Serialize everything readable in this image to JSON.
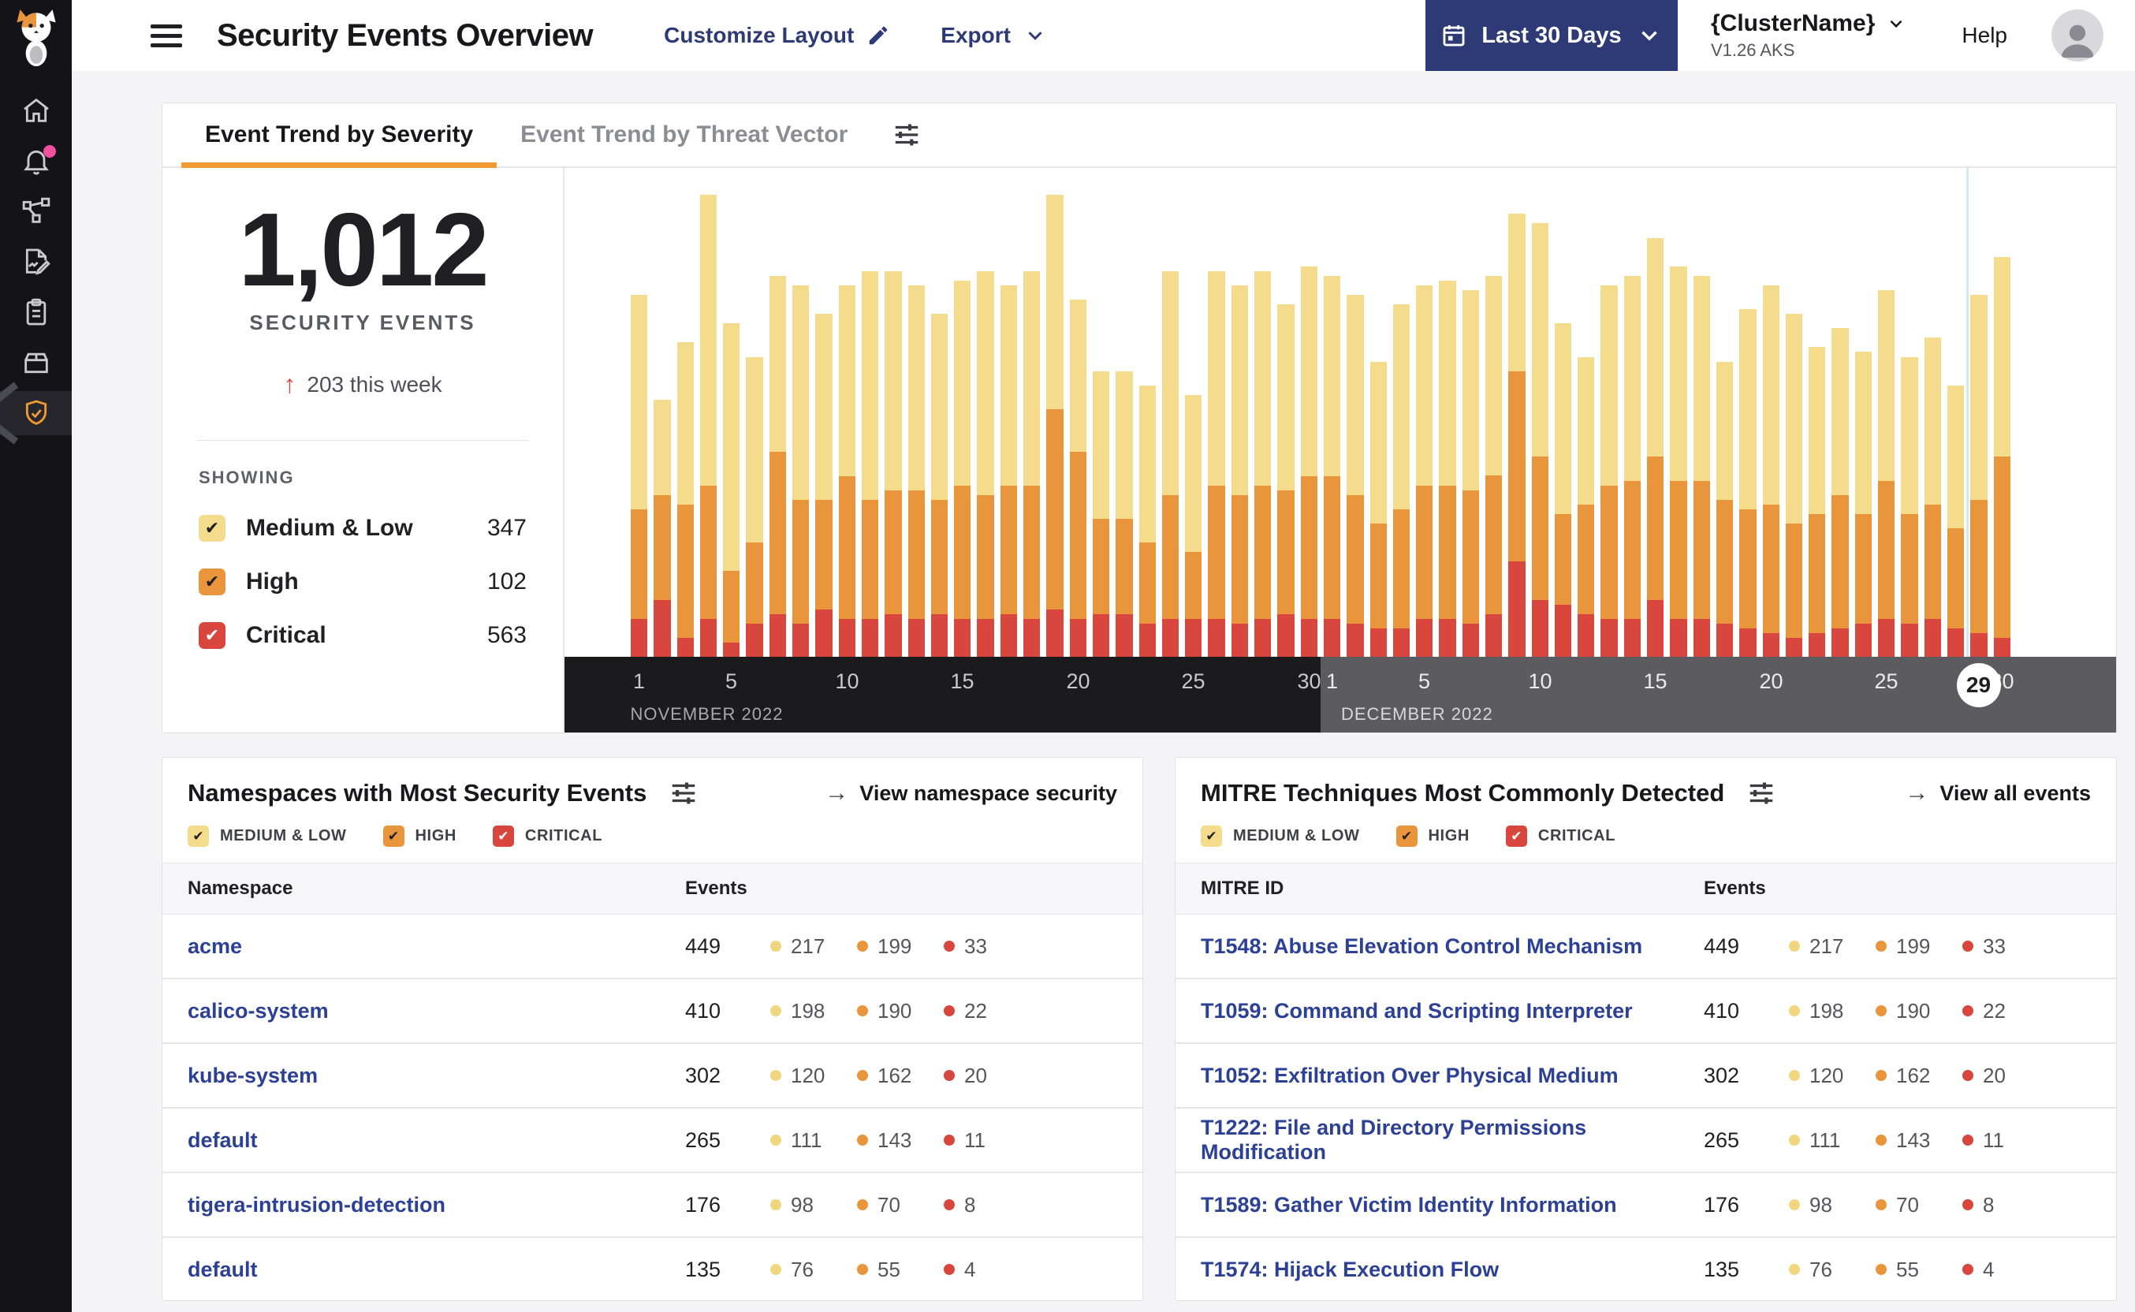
{
  "icons": {
    "check": "✔",
    "arrow_right": "→",
    "trend_up": "↑"
  },
  "colors": {
    "medium_low": "#f4dc8c",
    "high": "#e8953c",
    "critical": "#d8463e",
    "accent_orange": "#ef9a32",
    "navy": "#2d3a76",
    "link_blue": "#2c4195",
    "alert_pink": "#f0509e",
    "axis_november_bg": "#1b1b1e",
    "axis_december_bg": "#5c5c60",
    "hover_line_blue": "#d2e8f4"
  },
  "sidebar": {
    "items": [
      {
        "icon": "calico-cat-logo"
      },
      {
        "icon": "home-icon"
      },
      {
        "icon": "bell-icon",
        "badge": true
      },
      {
        "icon": "service-graph-icon"
      },
      {
        "icon": "report-edit-icon"
      },
      {
        "icon": "clipboard-icon"
      },
      {
        "icon": "box-icon"
      },
      {
        "icon": "shield-check-icon",
        "active": true
      }
    ]
  },
  "header": {
    "title": "Security Events Overview",
    "customize_label": "Customize Layout",
    "export_label": "Export",
    "date_range_label": "Last 30 Days",
    "cluster_name": "{ClusterName}",
    "cluster_version": "V1.26 AKS",
    "help_label": "Help"
  },
  "tabs": [
    {
      "label": "Event Trend by Severity",
      "active": true
    },
    {
      "label": "Event Trend by Threat Vector",
      "active": false
    }
  ],
  "summary": {
    "total": "1,012",
    "events_label": "SECURITY EVENTS",
    "delta": "203 this week",
    "showing_label": "SHOWING",
    "legend": [
      {
        "label": "Medium & Low",
        "count": "347",
        "severity": "medium_low"
      },
      {
        "label": "High",
        "count": "102",
        "severity": "high"
      },
      {
        "label": "Critical",
        "count": "563",
        "severity": "critical"
      }
    ]
  },
  "chart_data": {
    "type": "bar",
    "stacked": true,
    "legend_position": "left-panel",
    "grid": false,
    "series_names": [
      "Critical",
      "High",
      "Medium & Low"
    ],
    "value_unit": "percent of plot height (no y-axis shown in UI)",
    "selected_day_index": 58,
    "months": [
      {
        "label": "NOVEMBER 2022",
        "ticks": [
          1,
          5,
          10,
          15,
          20,
          25,
          30
        ]
      },
      {
        "label": "DECEMBER 2022",
        "ticks": [
          1,
          5,
          10,
          15,
          20,
          25,
          30
        ],
        "highlight_day": 29
      }
    ],
    "days": [
      {
        "date": "Nov 1",
        "critical": 8,
        "high": 23,
        "mediumLow": 45
      },
      {
        "date": "Nov 2",
        "critical": 12,
        "high": 22,
        "mediumLow": 20
      },
      {
        "date": "Nov 3",
        "critical": 4,
        "high": 28,
        "mediumLow": 34
      },
      {
        "date": "Nov 4",
        "critical": 8,
        "high": 28,
        "mediumLow": 61
      },
      {
        "date": "Nov 5",
        "critical": 3,
        "high": 15,
        "mediumLow": 52
      },
      {
        "date": "Nov 6",
        "critical": 7,
        "high": 17,
        "mediumLow": 39
      },
      {
        "date": "Nov 7",
        "critical": 9,
        "high": 34,
        "mediumLow": 37
      },
      {
        "date": "Nov 8",
        "critical": 7,
        "high": 26,
        "mediumLow": 45
      },
      {
        "date": "Nov 9",
        "critical": 10,
        "high": 23,
        "mediumLow": 39
      },
      {
        "date": "Nov 10",
        "critical": 8,
        "high": 30,
        "mediumLow": 40
      },
      {
        "date": "Nov 11",
        "critical": 8,
        "high": 25,
        "mediumLow": 48
      },
      {
        "date": "Nov 12",
        "critical": 9,
        "high": 26,
        "mediumLow": 46
      },
      {
        "date": "Nov 13",
        "critical": 8,
        "high": 27,
        "mediumLow": 43
      },
      {
        "date": "Nov 14",
        "critical": 9,
        "high": 24,
        "mediumLow": 39
      },
      {
        "date": "Nov 15",
        "critical": 8,
        "high": 28,
        "mediumLow": 43
      },
      {
        "date": "Nov 16",
        "critical": 8,
        "high": 26,
        "mediumLow": 47
      },
      {
        "date": "Nov 17",
        "critical": 9,
        "high": 27,
        "mediumLow": 42
      },
      {
        "date": "Nov 18",
        "critical": 8,
        "high": 28,
        "mediumLow": 45
      },
      {
        "date": "Nov 19",
        "critical": 10,
        "high": 42,
        "mediumLow": 45
      },
      {
        "date": "Nov 20",
        "critical": 8,
        "high": 35,
        "mediumLow": 32
      },
      {
        "date": "Nov 21",
        "critical": 9,
        "high": 20,
        "mediumLow": 31
      },
      {
        "date": "Nov 22",
        "critical": 9,
        "high": 20,
        "mediumLow": 31
      },
      {
        "date": "Nov 23",
        "critical": 7,
        "high": 17,
        "mediumLow": 33
      },
      {
        "date": "Nov 24",
        "critical": 8,
        "high": 26,
        "mediumLow": 47
      },
      {
        "date": "Nov 25",
        "critical": 8,
        "high": 14,
        "mediumLow": 33
      },
      {
        "date": "Nov 26",
        "critical": 8,
        "high": 28,
        "mediumLow": 45
      },
      {
        "date": "Nov 27",
        "critical": 7,
        "high": 27,
        "mediumLow": 44
      },
      {
        "date": "Nov 28",
        "critical": 8,
        "high": 28,
        "mediumLow": 45
      },
      {
        "date": "Nov 29",
        "critical": 9,
        "high": 26,
        "mediumLow": 39
      },
      {
        "date": "Nov 30",
        "critical": 8,
        "high": 30,
        "mediumLow": 44
      },
      {
        "date": "Dec 1",
        "critical": 8,
        "high": 30,
        "mediumLow": 42
      },
      {
        "date": "Dec 2",
        "critical": 7,
        "high": 27,
        "mediumLow": 42
      },
      {
        "date": "Dec 3",
        "critical": 6,
        "high": 22,
        "mediumLow": 34
      },
      {
        "date": "Dec 4",
        "critical": 6,
        "high": 25,
        "mediumLow": 43
      },
      {
        "date": "Dec 5",
        "critical": 8,
        "high": 28,
        "mediumLow": 42
      },
      {
        "date": "Dec 6",
        "critical": 8,
        "high": 28,
        "mediumLow": 43
      },
      {
        "date": "Dec 7",
        "critical": 7,
        "high": 28,
        "mediumLow": 42
      },
      {
        "date": "Dec 8",
        "critical": 9,
        "high": 29,
        "mediumLow": 42
      },
      {
        "date": "Dec 9",
        "critical": 20,
        "high": 40,
        "mediumLow": 33
      },
      {
        "date": "Dec 10",
        "critical": 12,
        "high": 30,
        "mediumLow": 49
      },
      {
        "date": "Dec 11",
        "critical": 11,
        "high": 19,
        "mediumLow": 40
      },
      {
        "date": "Dec 12",
        "critical": 9,
        "high": 23,
        "mediumLow": 31
      },
      {
        "date": "Dec 13",
        "critical": 8,
        "high": 28,
        "mediumLow": 42
      },
      {
        "date": "Dec 14",
        "critical": 8,
        "high": 29,
        "mediumLow": 43
      },
      {
        "date": "Dec 15",
        "critical": 12,
        "high": 30,
        "mediumLow": 46
      },
      {
        "date": "Dec 16",
        "critical": 8,
        "high": 29,
        "mediumLow": 45
      },
      {
        "date": "Dec 17",
        "critical": 8,
        "high": 29,
        "mediumLow": 43
      },
      {
        "date": "Dec 18",
        "critical": 7,
        "high": 26,
        "mediumLow": 29
      },
      {
        "date": "Dec 19",
        "critical": 6,
        "high": 25,
        "mediumLow": 42
      },
      {
        "date": "Dec 20",
        "critical": 5,
        "high": 27,
        "mediumLow": 46
      },
      {
        "date": "Dec 21",
        "critical": 4,
        "high": 24,
        "mediumLow": 44
      },
      {
        "date": "Dec 22",
        "critical": 5,
        "high": 25,
        "mediumLow": 35
      },
      {
        "date": "Dec 23",
        "critical": 6,
        "high": 28,
        "mediumLow": 35
      },
      {
        "date": "Dec 24",
        "critical": 7,
        "high": 23,
        "mediumLow": 34
      },
      {
        "date": "Dec 25",
        "critical": 8,
        "high": 29,
        "mediumLow": 40
      },
      {
        "date": "Dec 26",
        "critical": 7,
        "high": 23,
        "mediumLow": 33
      },
      {
        "date": "Dec 27",
        "critical": 8,
        "high": 24,
        "mediumLow": 35
      },
      {
        "date": "Dec 28",
        "critical": 6,
        "high": 21,
        "mediumLow": 30
      },
      {
        "date": "Dec 29",
        "critical": 5,
        "high": 28,
        "mediumLow": 43
      },
      {
        "date": "Dec 30",
        "critical": 4,
        "high": 38,
        "mediumLow": 42
      }
    ]
  },
  "namespaces_card": {
    "title": "Namespaces with Most Security Events",
    "link_label": "View namespace security",
    "filters": [
      {
        "label": "MEDIUM & LOW",
        "severity": "medium_low",
        "checked": true
      },
      {
        "label": "HIGH",
        "severity": "high",
        "checked": true
      },
      {
        "label": "CRITICAL",
        "severity": "critical",
        "checked": true
      }
    ],
    "columns": [
      "Namespace",
      "Events"
    ],
    "rows": [
      {
        "name": "acme",
        "total": "449",
        "medium": "217",
        "high": "199",
        "critical": "33"
      },
      {
        "name": "calico-system",
        "total": "410",
        "medium": "198",
        "high": "190",
        "critical": "22"
      },
      {
        "name": "kube-system",
        "total": "302",
        "medium": "120",
        "high": "162",
        "critical": "20"
      },
      {
        "name": "default",
        "total": "265",
        "medium": "111",
        "high": "143",
        "critical": "11"
      },
      {
        "name": "tigera-intrusion-detection",
        "total": "176",
        "medium": "98",
        "high": "70",
        "critical": "8"
      },
      {
        "name": "default",
        "total": "135",
        "medium": "76",
        "high": "55",
        "critical": "4"
      }
    ]
  },
  "mitre_card": {
    "title": "MITRE Techniques Most Commonly Detected",
    "link_label": "View all events",
    "filters": [
      {
        "label": "MEDIUM & LOW",
        "severity": "medium_low",
        "checked": true
      },
      {
        "label": "HIGH",
        "severity": "high",
        "checked": true
      },
      {
        "label": "CRITICAL",
        "severity": "critical",
        "checked": true
      }
    ],
    "columns": [
      "MITRE ID",
      "Events"
    ],
    "rows": [
      {
        "name": "T1548: Abuse Elevation Control Mechanism",
        "total": "449",
        "medium": "217",
        "high": "199",
        "critical": "33"
      },
      {
        "name": "T1059: Command and Scripting Interpreter",
        "total": "410",
        "medium": "198",
        "high": "190",
        "critical": "22"
      },
      {
        "name": "T1052: Exfiltration Over Physical Medium",
        "total": "302",
        "medium": "120",
        "high": "162",
        "critical": "20"
      },
      {
        "name": "T1222: File and Directory Permissions Modification",
        "total": "265",
        "medium": "111",
        "high": "143",
        "critical": "11"
      },
      {
        "name": "T1589: Gather Victim Identity Information",
        "total": "176",
        "medium": "98",
        "high": "70",
        "critical": "8"
      },
      {
        "name": "T1574: Hijack Execution Flow",
        "total": "135",
        "medium": "76",
        "high": "55",
        "critical": "4"
      }
    ]
  }
}
